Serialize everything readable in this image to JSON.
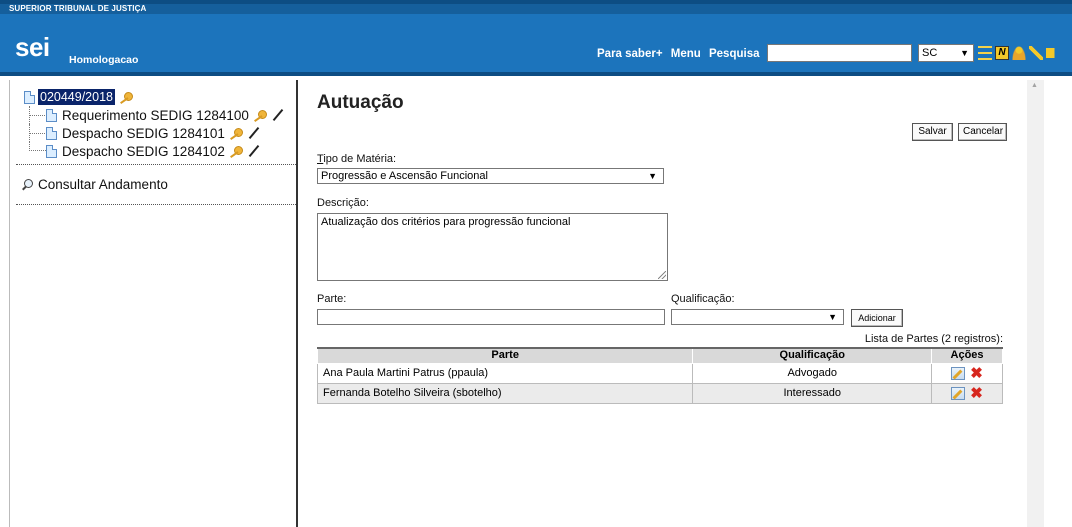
{
  "topbar": {
    "org_name": "SUPERIOR TRIBUNAL DE JUSTIÇA"
  },
  "header": {
    "logo": "sei",
    "environment": "Homologacao",
    "links": [
      "Para saber+",
      "Menu",
      "Pesquisa"
    ],
    "search_value": "",
    "unit": "SC",
    "icons": [
      "list-icon",
      "notes-icon",
      "user-icon",
      "tools-icon",
      "exit-icon"
    ]
  },
  "sidebar": {
    "process_number": "020449/2018",
    "documents": [
      {
        "label": "Requerimento SEDIG 1284100"
      },
      {
        "label": "Despacho SEDIG 1284101"
      },
      {
        "label": "Despacho SEDIG 1284102"
      }
    ],
    "consult_label": "Consultar Andamento"
  },
  "form": {
    "title": "Autuação",
    "save_label": "Salvar",
    "cancel_label": "Cancelar",
    "tipo_label_first": "T",
    "tipo_label_rest": "ipo de Matéria:",
    "tipo_value": "Progressão e Ascensão Funcional",
    "descricao_label": "Descrição:",
    "descricao_value": "Atualização dos critérios para progressão funcional",
    "parte_label": "Parte:",
    "parte_value": "",
    "qualificacao_label": "Qualificação:",
    "qualificacao_value": "",
    "add_label": "Adicionar",
    "list_count": "Lista de Partes (2 registros):"
  },
  "table": {
    "headers": [
      "Parte",
      "Qualificação",
      "Ações"
    ],
    "rows": [
      {
        "parte": "Ana Paula Martini Patrus (ppaula)",
        "qualificacao": "Advogado"
      },
      {
        "parte": "Fernanda Botelho Silveira (sbotelho)",
        "qualificacao": "Interessado"
      }
    ]
  }
}
